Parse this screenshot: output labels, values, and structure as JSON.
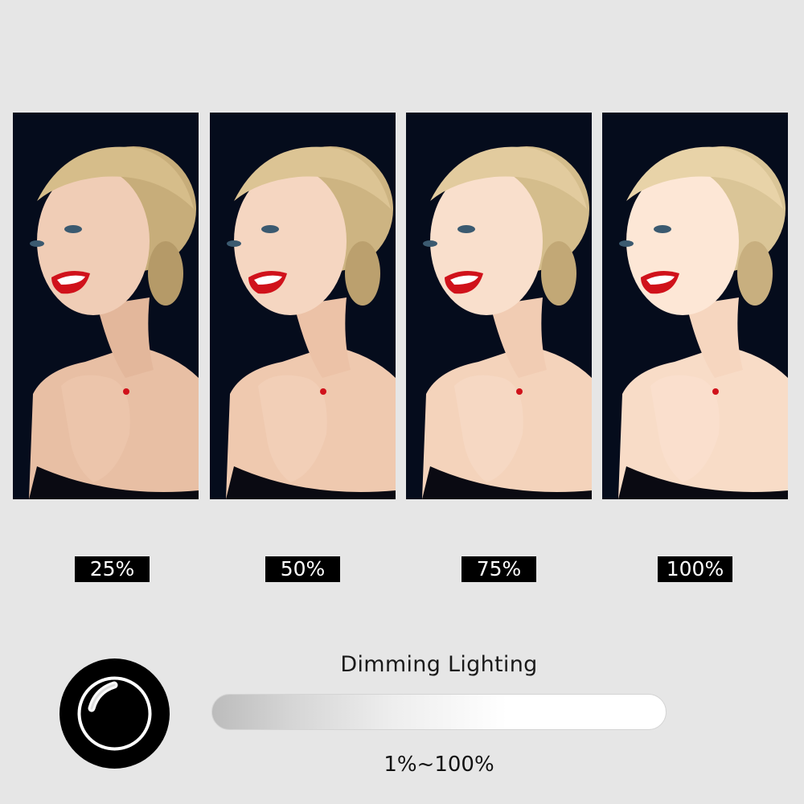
{
  "panels": [
    {
      "label": "25%",
      "brightness": 0.25
    },
    {
      "label": "50%",
      "brightness": 0.5
    },
    {
      "label": "75%",
      "brightness": 0.75
    },
    {
      "label": "100%",
      "brightness": 1.0
    }
  ],
  "dimming": {
    "title": "Dimming Lighting",
    "range": "1%~100%"
  },
  "colors": {
    "background": "#e6e6e6",
    "photo_background": "#050c1c",
    "label_background": "#000000",
    "lipstick": "#d0121b"
  },
  "icons": {
    "logo": "ring-light-icon"
  }
}
